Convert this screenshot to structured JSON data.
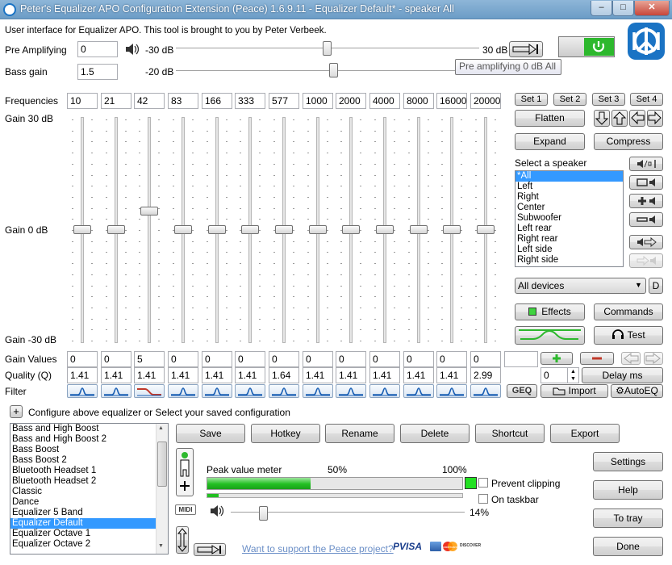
{
  "window": {
    "title": "Peter's Equalizer APO Configuration Extension (Peace) 1.6.9.11 - Equalizer Default* - speaker All",
    "min": "–",
    "max": "□",
    "close": "✕"
  },
  "intro": "User interface for Equalizer APO. This tool is brought to you by Peter Verbeek.",
  "preamp": {
    "label": "Pre Amplifying",
    "value": "0",
    "min_label": "-30 dB",
    "max_label": "30 dB",
    "level": 0.5,
    "tooltip": "Pre amplifying 0 dB All"
  },
  "bass": {
    "label": "Bass gain",
    "value": "1.5",
    "min_label": "-20 dB",
    "level": 0.52
  },
  "eq": {
    "freq_label": "Frequencies",
    "frequencies": [
      "10",
      "21",
      "42",
      "83",
      "166",
      "333",
      "577",
      "1000",
      "2000",
      "4000",
      "8000",
      "16000",
      "20000"
    ],
    "gain_top": "Gain 30 dB",
    "gain_mid": "Gain 0 dB",
    "gain_bottom": "Gain -30 dB",
    "gain_values_label": "Gain Values",
    "gains": [
      "0",
      "0",
      "5",
      "0",
      "0",
      "0",
      "0",
      "0",
      "0",
      "0",
      "0",
      "0",
      "0",
      ""
    ],
    "quality_label": "Quality (Q)",
    "qualities": [
      "1.41",
      "1.41",
      "1.41",
      "1.41",
      "1.41",
      "1.41",
      "1.64",
      "1.41",
      "1.41",
      "1.41",
      "1.41",
      "1.41",
      "2.99"
    ],
    "filter_label": "Filter",
    "filter_types": [
      "peak",
      "peak",
      "shelf",
      "peak",
      "peak",
      "peak",
      "peak",
      "peak",
      "peak",
      "peak",
      "peak",
      "peak",
      "peak"
    ],
    "range_db": [
      -30,
      30
    ]
  },
  "sets": [
    "Set 1",
    "Set 2",
    "Set 3",
    "Set 4"
  ],
  "buttons": {
    "flatten": "Flatten",
    "expand": "Expand",
    "compress": "Compress",
    "effects": "Effects",
    "commands": "Commands",
    "test": "Test",
    "delay": "Delay ms",
    "import": "Import",
    "autoeq": "AutoEQ",
    "geq": "GEQ",
    "d": "D",
    "midi": "MIDI"
  },
  "delay_value": "0",
  "speaker": {
    "label": "Select a speaker",
    "items": [
      "*All",
      "Left",
      "Right",
      "Center",
      "Subwoofer",
      "Left rear",
      "Right rear",
      "Left side",
      "Right side"
    ],
    "selected": 0,
    "device": "All devices"
  },
  "config": {
    "toggle": "+",
    "label": "Configure above equalizer or Select your saved configuration",
    "items": [
      "Bass and High Boost",
      "Bass and High Boost 2",
      "Bass Boost",
      "Bass Boost 2",
      "Bluetooth Headset 1",
      "Bluetooth Headset 2",
      "Classic",
      "Dance",
      "Equalizer 5 Band",
      "Equalizer Default",
      "Equalizer Octave 1",
      "Equalizer Octave 2"
    ],
    "selected": 9
  },
  "actions": [
    "Save",
    "Hotkey",
    "Rename",
    "Delete",
    "Shortcut",
    "Export"
  ],
  "meter": {
    "label": "Peak value meter",
    "p50": "50%",
    "p100": "100%",
    "level": 0.5,
    "volume": "14%",
    "volume_level": 0.14
  },
  "checks": {
    "prevent": "Prevent clipping",
    "taskbar": "On taskbar"
  },
  "side": {
    "settings": "Settings",
    "help": "Help",
    "tray": "To tray",
    "done": "Done"
  },
  "support": "Want to support the Peace project?",
  "payments": [
    "PVISA",
    "mastercard",
    "DISCOVER"
  ],
  "colors": {
    "accent": "#3399ff",
    "power": "#2db82d",
    "meter": "#22c022",
    "link": "#6b8fc7",
    "reset": "#c0392b"
  }
}
